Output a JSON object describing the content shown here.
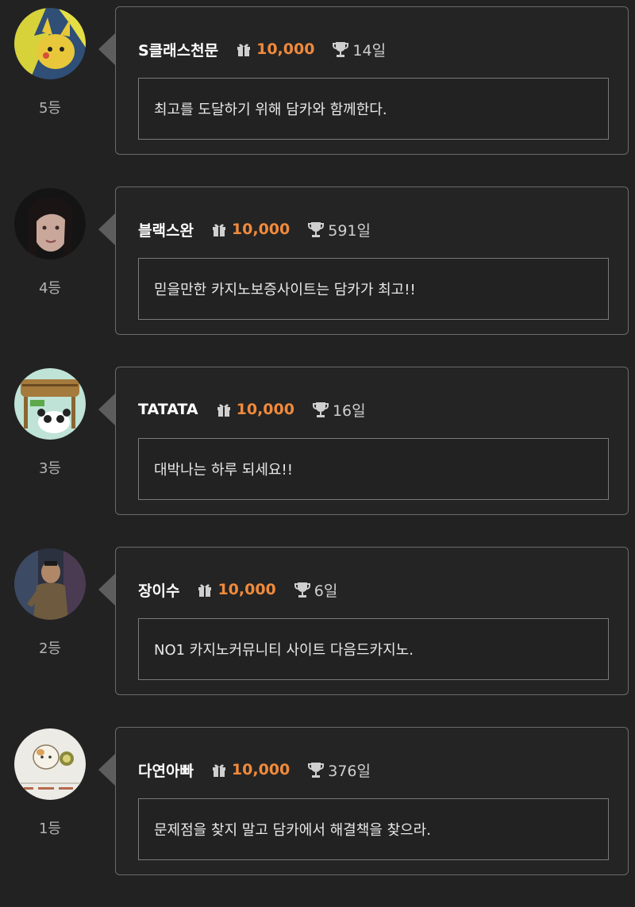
{
  "colors": {
    "background": "#222222",
    "card_border": "#6a6a6a",
    "points": "#f08a3c",
    "username": "#ffffff",
    "muted": "#b4b4b4"
  },
  "icons": {
    "points": "gift-icon",
    "days": "trophy-icon"
  },
  "entries": [
    {
      "rank": "5등",
      "username": "S클래스천문",
      "points": "10,000",
      "days": "14일",
      "message": "최고를 도달하기 위해 담카와 함께한다."
    },
    {
      "rank": "4등",
      "username": "블랙스완",
      "points": "10,000",
      "days": "591일",
      "message": "믿을만한 카지노보증사이트는 담카가 최고!!"
    },
    {
      "rank": "3등",
      "username": "TATATA",
      "points": "10,000",
      "days": "16일",
      "message": "대박나는 하루 되세요!!"
    },
    {
      "rank": "2등",
      "username": "장이수",
      "points": "10,000",
      "days": "6일",
      "message": "NO1 카지노커뮤니티 사이트 다음드카지노."
    },
    {
      "rank": "1등",
      "username": "다연아빠",
      "points": "10,000",
      "days": "376일",
      "message": "문제점을 찾지 말고 담카에서 해결책을 찾으라."
    }
  ]
}
